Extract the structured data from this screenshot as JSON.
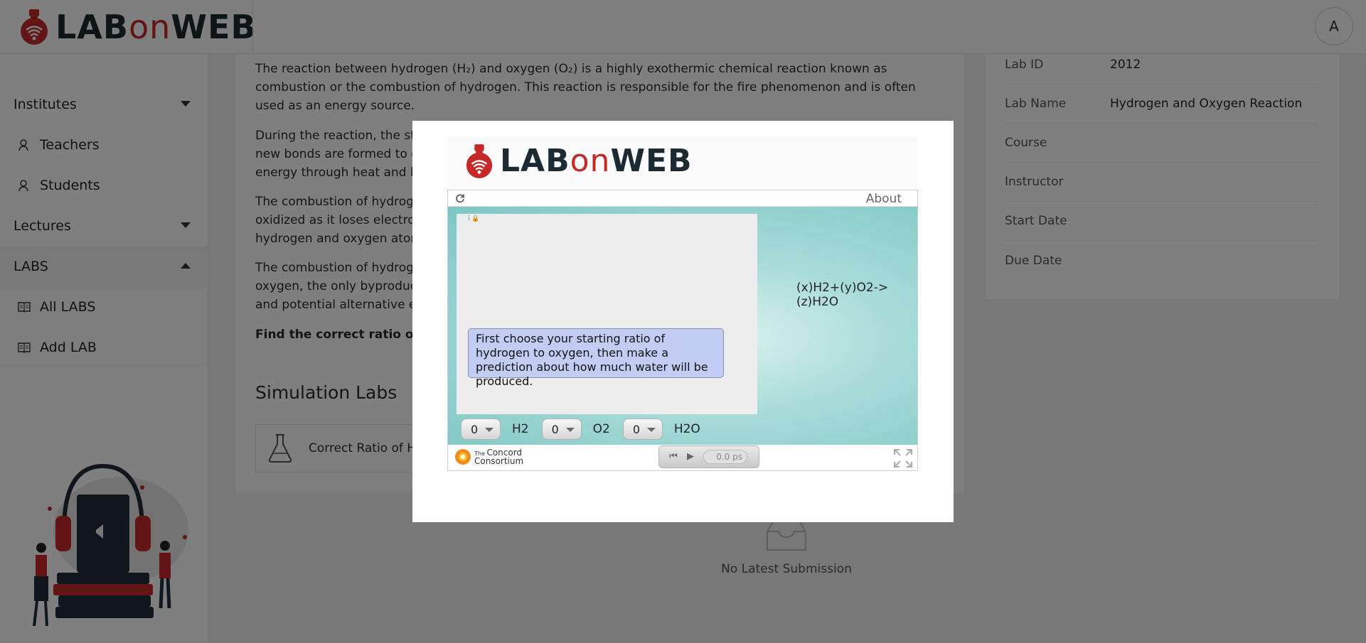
{
  "header": {
    "logo_lab": "LAB",
    "logo_on": "on",
    "logo_web": "WEB",
    "avatar_initial": "A"
  },
  "sidebar": {
    "institutes": "Institutes",
    "teachers": "Teachers",
    "students": "Students",
    "lectures": "Lectures",
    "labs": "LABS",
    "all_labs": "All LABS",
    "add_lab": "Add LAB"
  },
  "main": {
    "para1": "The reaction between hydrogen (H₂) and oxygen (O₂) is a highly exothermic chemical reaction known as combustion or the combustion of hydrogen. This reaction is responsible for the fire phenomenon and is often used as an energy source.",
    "para2_l1": "During the reaction, the stro",
    "para2_l2": "new bonds are formed to c",
    "para2_l3": "energy through heat and li",
    "para3_l1": "The combustion of hydroge",
    "para3_l2": "oxidized as it loses electron",
    "para3_l3": "hydrogen and oxygen atom",
    "para4_l1": "The combustion of hydroge",
    "para4_l2": "oxygen, the only byproduct",
    "para4_l3": "and potential alternative en",
    "find_text": "Find the correct ratio of Hyd",
    "sim_title": "Simulation Labs",
    "sim_card_label": "Correct Ratio of Hy"
  },
  "info": {
    "rows": [
      {
        "key": "Lab ID",
        "value": "2012"
      },
      {
        "key": "Lab Name",
        "value": "Hydrogen and Oxygen Reaction"
      },
      {
        "key": "Course",
        "value": ""
      },
      {
        "key": "Instructor",
        "value": ""
      },
      {
        "key": "Start Date",
        "value": ""
      },
      {
        "key": "Due Date",
        "value": ""
      }
    ]
  },
  "submission": {
    "empty_text": "No Latest Submission"
  },
  "modal": {
    "about": "About",
    "prompt": "First choose your starting ratio of hydrogen to oxygen, then make a prediction about how much water will be produced.",
    "equation": "(x)H2+(y)O2->(z)H2O",
    "h2_value": "0",
    "h2_label": "H2",
    "o2_value": "0",
    "o2_label": "O2",
    "h2o_value": "0",
    "h2o_label": "H2O",
    "concord_the": "The",
    "concord_concord": "Concord",
    "concord_consortium": "Consortium",
    "time": "0.0 ps"
  },
  "colors": {
    "brand_red": "#c62828",
    "brand_dark": "#1c2b33",
    "sim_teal": "#7cc6c4",
    "prompt_bg": "#c3cdf4"
  },
  "icons": {
    "logo": "flask-wifi-icon",
    "user": "person-icon",
    "book": "book-icon",
    "reload": "reload-icon",
    "fullscreen": "fullscreen-icon"
  }
}
